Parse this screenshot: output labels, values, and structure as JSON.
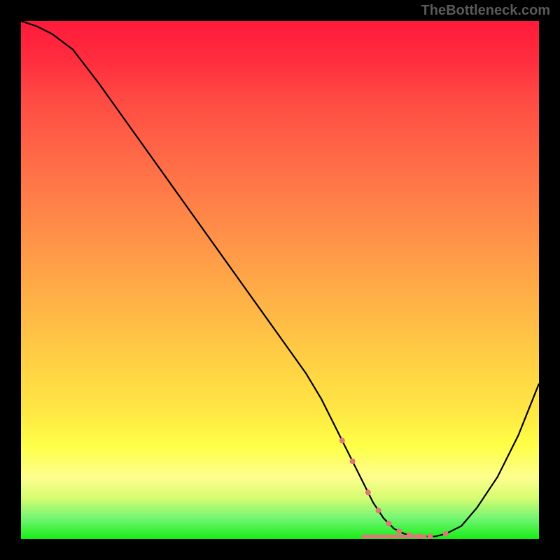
{
  "watermark": "TheBottleneck.com",
  "chart_data": {
    "type": "line",
    "title": "",
    "xlabel": "",
    "ylabel": "",
    "xlim": [
      0,
      100
    ],
    "ylim": [
      0,
      100
    ],
    "x": [
      0,
      3,
      6,
      10,
      15,
      20,
      25,
      30,
      35,
      40,
      45,
      50,
      55,
      58,
      60,
      62,
      64,
      66,
      68,
      70,
      72,
      74,
      76,
      78,
      80,
      82,
      85,
      88,
      92,
      96,
      100
    ],
    "values": [
      100,
      99,
      97.5,
      94.5,
      88,
      81,
      74,
      67,
      60,
      53,
      46,
      39,
      32,
      27,
      23,
      19,
      15,
      11,
      7,
      4,
      2,
      1,
      0.5,
      0.5,
      0.5,
      1,
      2.5,
      6,
      12,
      20,
      30
    ],
    "flat_region": {
      "x_start": 62,
      "x_end": 82,
      "marker_color": "#e27676",
      "marker_size": 4
    },
    "line_color": "#000000",
    "background": "red-yellow-green vertical gradient"
  }
}
